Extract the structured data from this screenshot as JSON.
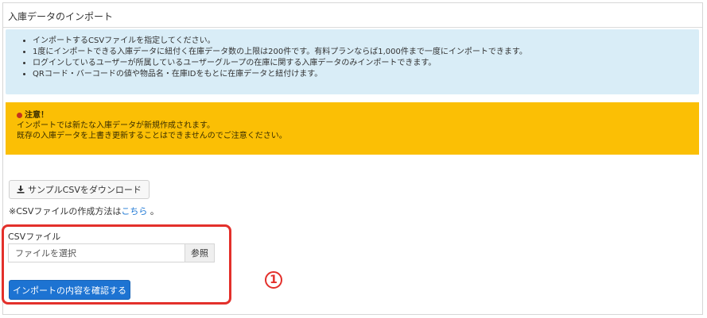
{
  "page": {
    "title": "入庫データのインポート"
  },
  "info": {
    "items": [
      "インポートするCSVファイルを指定してください。",
      "1度にインポートできる入庫データに紐付く在庫データ数の上限は200件です。有料プランならば1,000件まで一度にインポートできます。",
      "ログインしているユーザーが所属しているユーザーグループの在庫に関する入庫データのみインポートできます。",
      "QRコード・バーコードの値や物品名・在庫IDをもとに在庫データと紐付けます。"
    ]
  },
  "warning": {
    "heading": "注意！",
    "lines": [
      "インポートでは新たな入庫データが新規作成されます。",
      "既存の入庫データを上書き更新することはできませんのでご注意ください。"
    ]
  },
  "download": {
    "label": "サンプルCSVをダウンロード",
    "icon": "download-icon"
  },
  "note": {
    "prefix": "※CSVファイルの作成方法は",
    "link": "こちら",
    "suffix": " 。"
  },
  "file": {
    "label": "CSVファイル",
    "placeholder": "ファイルを選択",
    "browse_label": "参照"
  },
  "submit": {
    "label": "インポートの内容を確認する"
  },
  "annotation": {
    "number": "①",
    "color": "#e3302b"
  },
  "colors": {
    "info_bg": "#d9edf7",
    "warning_bg": "#fbbf05",
    "primary": "#1d73d2",
    "link": "#1e78d5"
  }
}
